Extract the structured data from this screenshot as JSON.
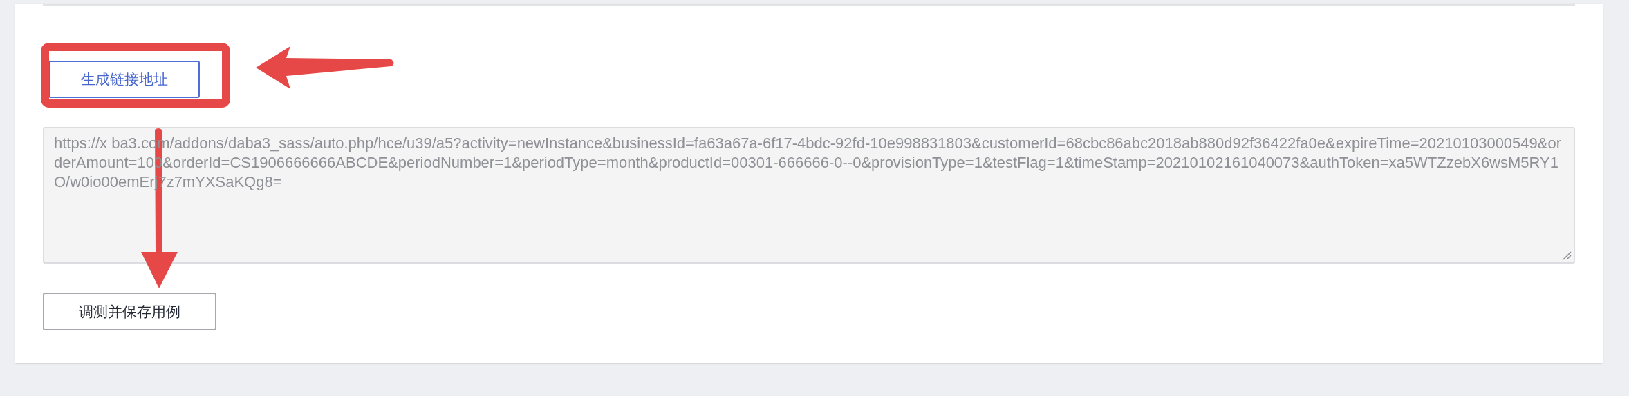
{
  "generate_button": {
    "label": "生成链接地址"
  },
  "url_field": {
    "value": "https://x   ba3.com/addons/daba3_sass/auto.php/hce/u39/a5?activity=newInstance&businessId=fa63a67a-6f17-4bdc-92fd-10e998831803&customerId=68cbc86abc2018ab880d92f36422fa0e&expireTime=20210103000549&orderAmount=100&orderId=CS1906666666ABCDE&periodNumber=1&periodType=month&productId=00301-666666-0--0&provisionType=1&testFlag=1&timeStamp=20210102161040073&authToken=xa5WTZzebX6wsM5RY1O/w0io00emErj7z7mYXSaKQg8="
  },
  "save_button": {
    "label": "调测并保存用例"
  }
}
